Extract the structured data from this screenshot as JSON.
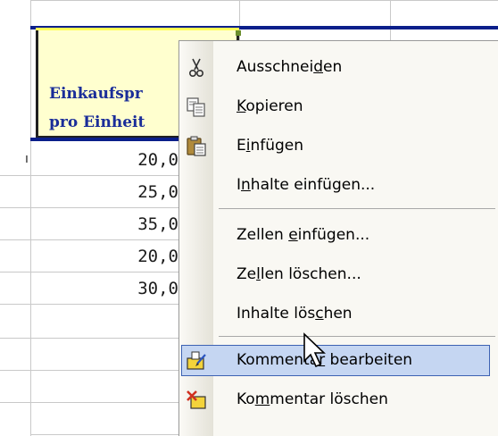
{
  "sheet": {
    "header": {
      "line1": "Einkaufspr",
      "line2": "pro Einheit"
    },
    "row_label": "ı",
    "values": [
      "20,0",
      "25,0",
      "35,0",
      "20,0",
      "30,0"
    ]
  },
  "menu": {
    "items": [
      {
        "name": "cut",
        "pre": "Ausschnei",
        "ul": "d",
        "post": "en",
        "icon": "scissors-icon"
      },
      {
        "name": "copy",
        "pre": "",
        "ul": "K",
        "post": "opieren",
        "icon": "copy-icon"
      },
      {
        "name": "paste",
        "pre": "E",
        "ul": "i",
        "post": "nfügen",
        "icon": "paste-icon"
      },
      {
        "name": "paste-special",
        "pre": "I",
        "ul": "n",
        "post": "halte einfügen...",
        "icon": ""
      },
      {
        "name": "insert-cells",
        "pre": "Zellen ",
        "ul": "e",
        "post": "infügen...",
        "icon": ""
      },
      {
        "name": "delete-cells",
        "pre": "Ze",
        "ul": "l",
        "post": "len löschen...",
        "icon": ""
      },
      {
        "name": "clear-contents",
        "pre": "Inhalte lös",
        "ul": "c",
        "post": "hen",
        "icon": ""
      },
      {
        "name": "edit-comment",
        "pre": "Kommenta",
        "ul": "r",
        "post": " bearbeiten",
        "icon": "edit-comment-icon"
      },
      {
        "name": "delete-comment",
        "pre": "Ko",
        "ul": "m",
        "post": "mentar löschen",
        "icon": "delete-comment-icon"
      }
    ],
    "highlighted": "edit-comment"
  }
}
